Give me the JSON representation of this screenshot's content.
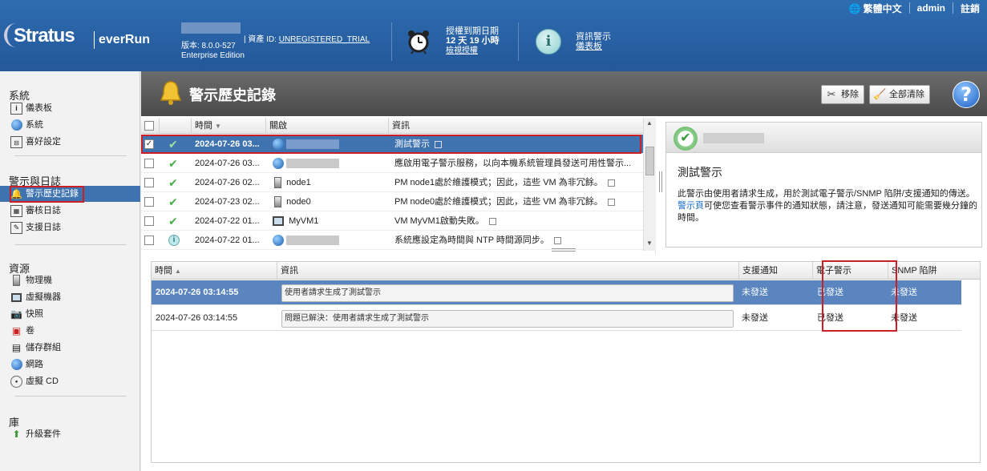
{
  "header": {
    "logo": {
      "brand": "Stratus",
      "product": "everRun"
    },
    "version": "版本: 8.0.0-527",
    "edition": "Enterprise Edition",
    "asset_label": "| 資產 ID:",
    "asset_value": "UNREGISTERED_TRIAL",
    "license": {
      "line1": "授權到期日期",
      "line2": "12 天 19 小時",
      "link": "檢視授權"
    },
    "alerts": {
      "line1": "資訊警示",
      "link": "儀表板"
    },
    "top_right": {
      "language": "繁體中文",
      "user": "admin",
      "logout": "註銷"
    }
  },
  "sidebar": {
    "sections": [
      {
        "title": "系統",
        "items": [
          {
            "label": "儀表板",
            "icon": "dashboard-icon"
          },
          {
            "label": "系統",
            "icon": "system-globe-icon"
          },
          {
            "label": "喜好設定",
            "icon": "preferences-icon"
          }
        ]
      },
      {
        "title": "警示與日誌",
        "items": [
          {
            "label": "警示歷史記錄",
            "icon": "bell-icon"
          },
          {
            "label": "審核日誌",
            "icon": "calendar-icon"
          },
          {
            "label": "支援日誌",
            "icon": "support-log-icon"
          }
        ]
      },
      {
        "title": "資源",
        "items": [
          {
            "label": "物理機",
            "icon": "physical-machine-icon"
          },
          {
            "label": "虛擬機器",
            "icon": "virtual-machine-icon"
          },
          {
            "label": "快照",
            "icon": "camera-icon"
          },
          {
            "label": "卷",
            "icon": "volume-icon"
          },
          {
            "label": "儲存群組",
            "icon": "storage-group-icon"
          },
          {
            "label": "網路",
            "icon": "network-icon"
          },
          {
            "label": "虛擬 CD",
            "icon": "cd-icon"
          }
        ]
      },
      {
        "title": "庫",
        "items": [
          {
            "label": "升級套件",
            "icon": "upgrade-kit-icon"
          }
        ]
      }
    ]
  },
  "page": {
    "title": "警示歷史記錄",
    "buttons": {
      "remove": "移除",
      "clear_all": "全部清除"
    },
    "help": "?"
  },
  "alerts_table": {
    "columns": [
      "時間",
      "關啟",
      "資訊"
    ],
    "rows": [
      {
        "checked": true,
        "status": "ok",
        "time": "2024-07-26 03...",
        "source_icon": "globe",
        "source": "",
        "info": "測試警示"
      },
      {
        "checked": false,
        "status": "ok",
        "time": "2024-07-26 03...",
        "source_icon": "globe",
        "source": "",
        "info": "應啟用電子警示服務，以向本機系統管理員發送可用性警示..."
      },
      {
        "checked": false,
        "status": "ok",
        "time": "2024-07-26 02...",
        "source_icon": "pm",
        "source": "node1",
        "info": "PM node1處於維護模式；因此，這些 VM 為非冗餘。"
      },
      {
        "checked": false,
        "status": "ok",
        "time": "2024-07-23 02...",
        "source_icon": "pm",
        "source": "node0",
        "info": "PM node0處於維護模式；因此，這些 VM 為非冗餘。"
      },
      {
        "checked": false,
        "status": "ok",
        "time": "2024-07-22 01...",
        "source_icon": "vm",
        "source": "MyVM1",
        "info": "VM MyVM1啟動失敗。"
      },
      {
        "checked": false,
        "status": "info",
        "time": "2024-07-22 01...",
        "source_icon": "globe",
        "source": "",
        "info": "系統應設定為時間與 NTP 時間源同步。"
      }
    ]
  },
  "detail": {
    "title": "測試警示",
    "desc1": "此警示由使用者請求生成，用於測試電子警示/SNMP 陷阱/支援通知的傳送。",
    "link": "警示頁",
    "desc2": "可使您查看警示事件的通知狀態，請注意，發送通知可能需要幾分鐘的時間。"
  },
  "notify_table": {
    "columns": [
      "時間",
      "資訊",
      "支援通知",
      "電子警示",
      "SNMP 陷阱"
    ],
    "rows": [
      {
        "time": "2024-07-26 03:14:55",
        "info": "使用者請求生成了測試警示",
        "support": "未發送",
        "email": "已發送",
        "snmp": "未發送"
      },
      {
        "time": "2024-07-26 03:14:55",
        "info": "問題已解決：使用者請求生成了測試警示",
        "support": "未發送",
        "email": "已發送",
        "snmp": "未發送"
      }
    ]
  }
}
